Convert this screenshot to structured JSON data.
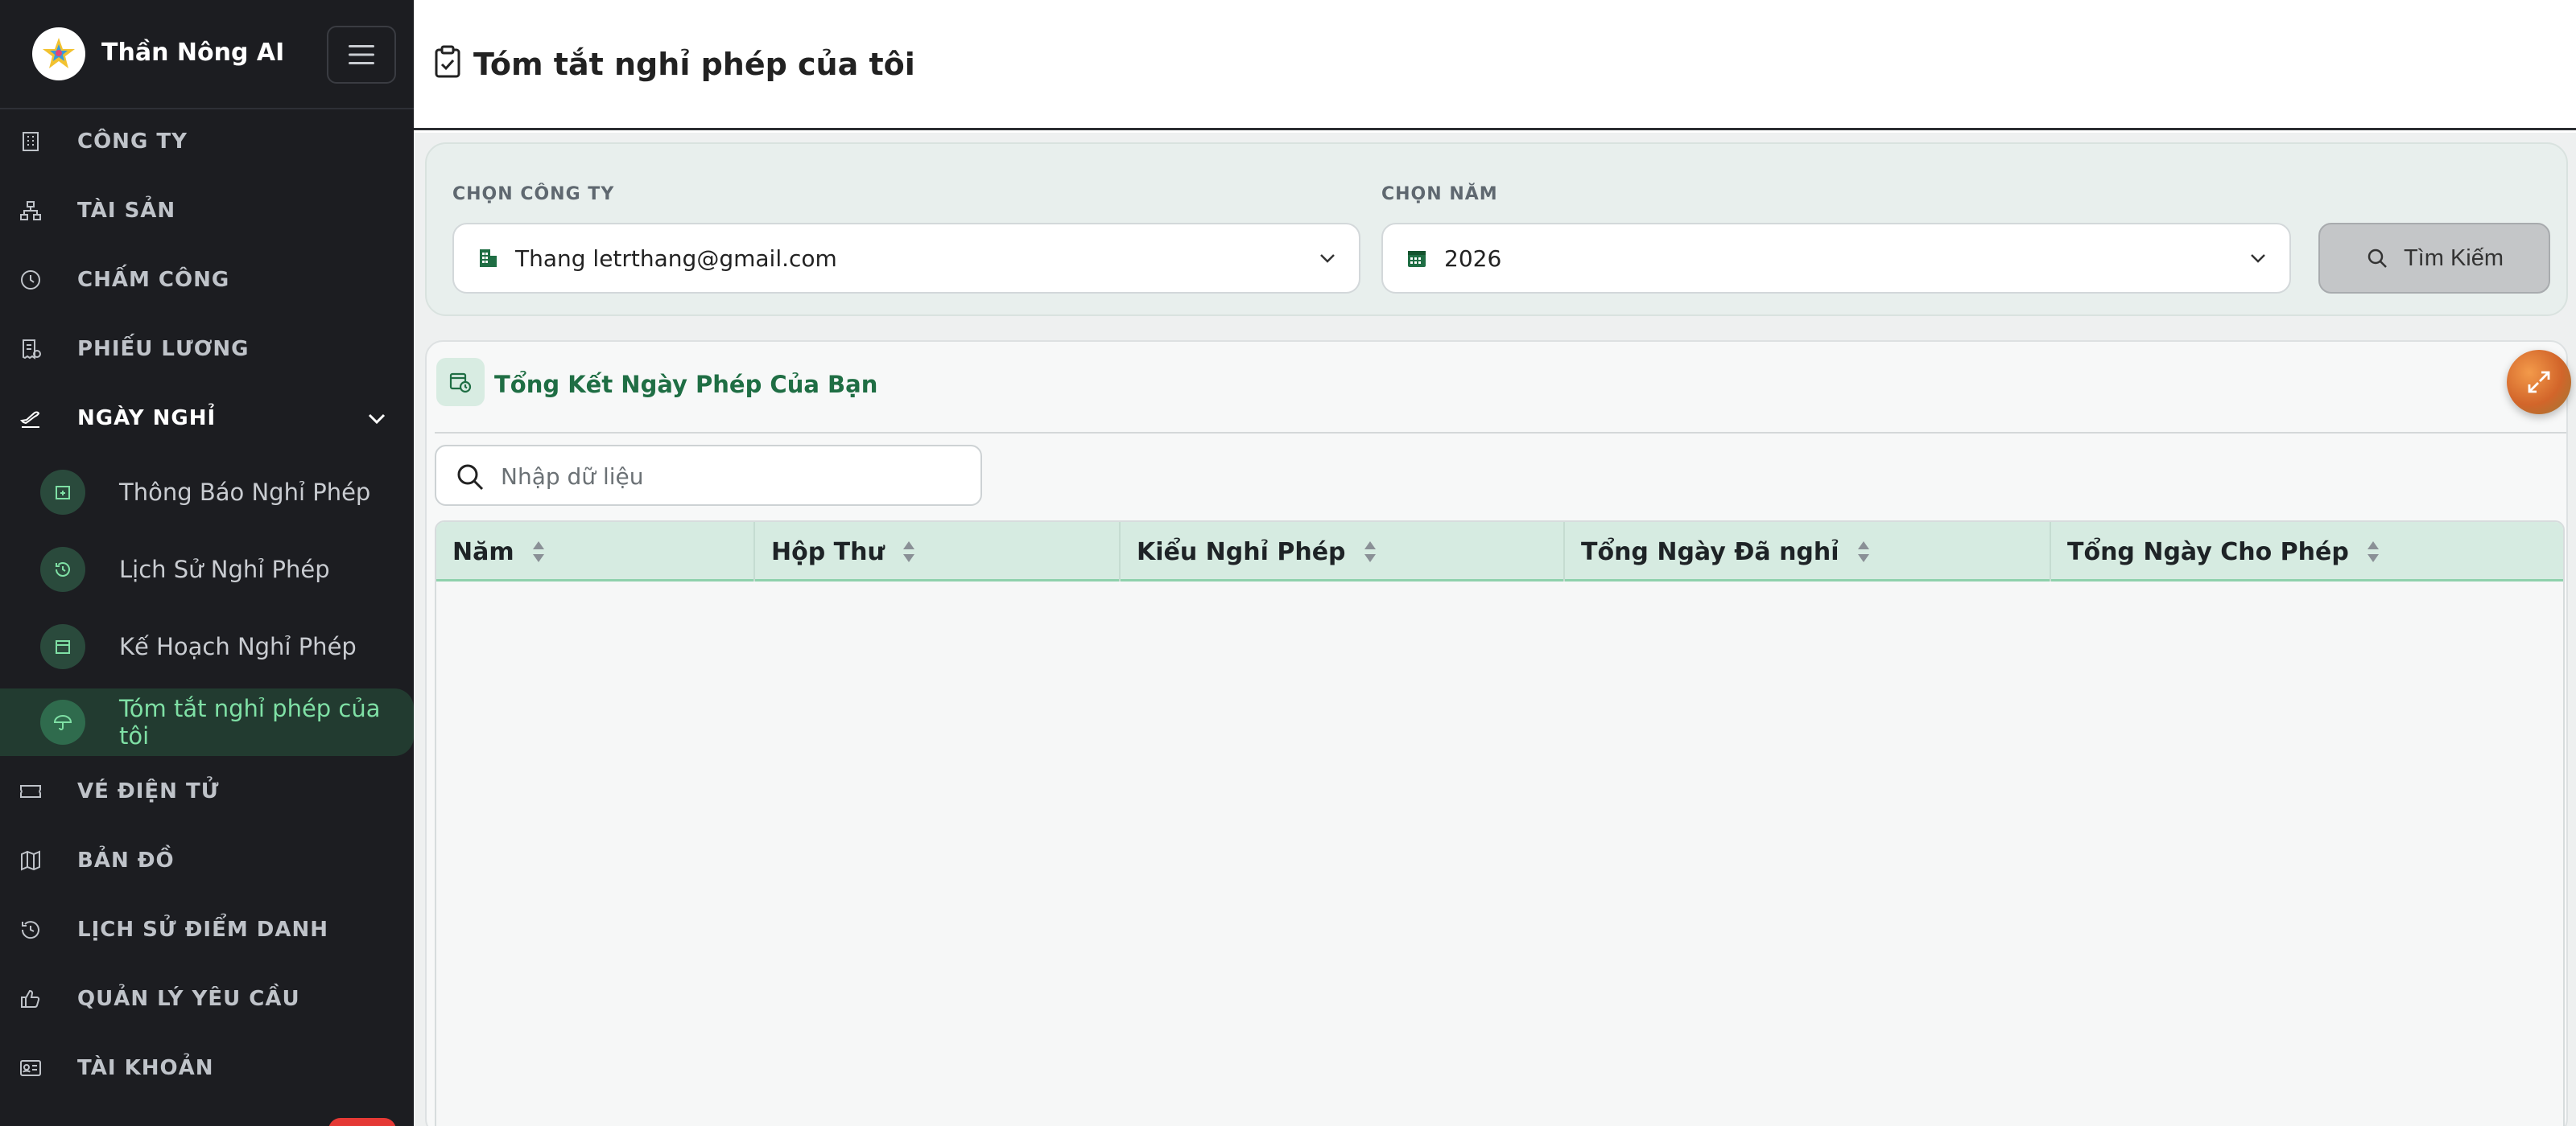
{
  "app": {
    "name": "Thần Nông AI"
  },
  "sidebar": {
    "items": [
      {
        "key": "company",
        "label": "CÔNG TY"
      },
      {
        "key": "assets",
        "label": "TÀI SẢN"
      },
      {
        "key": "attendance",
        "label": "CHẤM CÔNG"
      },
      {
        "key": "payslip",
        "label": "PHIẾU LƯƠNG"
      },
      {
        "key": "leave",
        "label": "NGÀY NGHỈ"
      },
      {
        "key": "eticket",
        "label": "VÉ ĐIỆN TỬ"
      },
      {
        "key": "map",
        "label": "BẢN ĐỒ"
      },
      {
        "key": "checkin-history",
        "label": "LỊCH SỬ ĐIỂM DANH"
      },
      {
        "key": "requests",
        "label": "QUẢN LÝ YÊU CẦU"
      },
      {
        "key": "account",
        "label": "TÀI KHOẢN"
      }
    ],
    "leave_sub": [
      {
        "label": "Thông Báo Nghỉ Phép"
      },
      {
        "label": "Lịch Sử Nghỉ Phép"
      },
      {
        "label": "Kế Hoạch Nghỉ Phép"
      },
      {
        "label": "Tóm tắt nghỉ phép của tôi"
      }
    ]
  },
  "header": {
    "title": "Tóm tắt nghỉ phép của tôi"
  },
  "filters": {
    "company_label": "CHỌN CÔNG TY",
    "company_value": "Thang letrthang@gmail.com",
    "year_label": "CHỌN NĂM",
    "year_value": "2026",
    "search_button": "Tìm Kiếm"
  },
  "summary": {
    "title": "Tổng Kết Ngày Phép Của Bạn",
    "search_placeholder": "Nhập dữ liệu",
    "columns": [
      "Năm",
      "Hộp Thư",
      "Kiểu Nghỉ Phép",
      "Tổng Ngày Đã nghỉ",
      "Tổng Ngày Cho Phép"
    ],
    "rows": []
  },
  "colors": {
    "sidebar_bg": "#1c1d21",
    "accent_green": "#1f6e44",
    "active_text": "#7fe0a5",
    "table_header_bg": "#d6ebe1"
  }
}
